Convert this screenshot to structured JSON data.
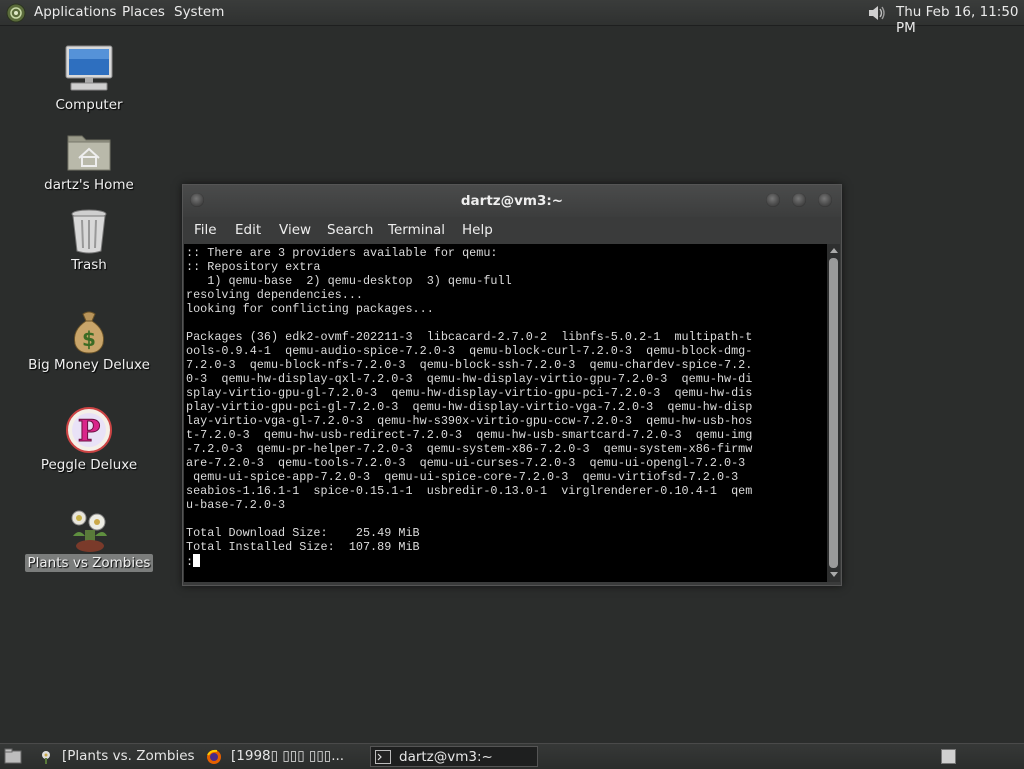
{
  "top_panel": {
    "menus": [
      "Applications",
      "Places",
      "System"
    ],
    "clock": "Thu Feb 16, 11:50 PM",
    "icons": {
      "logo": "mate-logo-icon",
      "volume": "volume-icon"
    }
  },
  "desktop": {
    "icons": [
      {
        "label": "Computer",
        "icon": "computer-icon"
      },
      {
        "label": "dartz's Home",
        "icon": "home-folder-icon"
      },
      {
        "label": "Trash",
        "icon": "trash-icon"
      },
      {
        "label": "Big Money Deluxe",
        "icon": "money-bag-icon"
      },
      {
        "label": "Peggle Deluxe",
        "icon": "peggle-icon"
      },
      {
        "label": "Plants vs Zombies",
        "icon": "plants-vs-zombies-icon",
        "selected": true
      }
    ]
  },
  "terminal": {
    "title": "dartz@vm3:~",
    "menu": [
      "File",
      "Edit",
      "View",
      "Search",
      "Terminal",
      "Help"
    ],
    "lines": [
      ":: There are 3 providers available for qemu:",
      ":: Repository extra",
      "   1) qemu-base  2) qemu-desktop  3) qemu-full",
      "resolving dependencies...",
      "looking for conflicting packages...",
      "",
      "Packages (36) edk2-ovmf-202211-3  libcacard-2.7.0-2  libnfs-5.0.2-1  multipath-t",
      "ools-0.9.4-1  qemu-audio-spice-7.2.0-3  qemu-block-curl-7.2.0-3  qemu-block-dmg-",
      "7.2.0-3  qemu-block-nfs-7.2.0-3  qemu-block-ssh-7.2.0-3  qemu-chardev-spice-7.2.",
      "0-3  qemu-hw-display-qxl-7.2.0-3  qemu-hw-display-virtio-gpu-7.2.0-3  qemu-hw-di",
      "splay-virtio-gpu-gl-7.2.0-3  qemu-hw-display-virtio-gpu-pci-7.2.0-3  qemu-hw-dis",
      "play-virtio-gpu-pci-gl-7.2.0-3  qemu-hw-display-virtio-vga-7.2.0-3  qemu-hw-disp",
      "lay-virtio-vga-gl-7.2.0-3  qemu-hw-s390x-virtio-gpu-ccw-7.2.0-3  qemu-hw-usb-hos",
      "t-7.2.0-3  qemu-hw-usb-redirect-7.2.0-3  qemu-hw-usb-smartcard-7.2.0-3  qemu-img",
      "-7.2.0-3  qemu-pr-helper-7.2.0-3  qemu-system-x86-7.2.0-3  qemu-system-x86-firmw",
      "are-7.2.0-3  qemu-tools-7.2.0-3  qemu-ui-curses-7.2.0-3  qemu-ui-opengl-7.2.0-3",
      " qemu-ui-spice-app-7.2.0-3  qemu-ui-spice-core-7.2.0-3  qemu-virtiofsd-7.2.0-3",
      "seabios-1.16.1-1  spice-0.15.1-1  usbredir-0.13.0-1  virglrenderer-0.10.4-1  qem",
      "u-base-7.2.0-3",
      "",
      "Total Download Size:    25.49 MiB",
      "Total Installed Size:  107.89 MiB",
      ""
    ],
    "prompt": ":"
  },
  "taskbar": {
    "tasks": [
      {
        "label": "[Plants vs. Zombies]",
        "icon": "plants-vs-zombies-icon"
      },
      {
        "label": "[1998▯ ▯▯▯ ▯▯▯...",
        "icon": "firefox-icon"
      },
      {
        "label": "dartz@vm3:~",
        "icon": "terminal-icon",
        "active": true
      }
    ],
    "icons": {
      "show_desktop": "show-desktop-icon",
      "workspace": "workspace-switcher-icon"
    }
  }
}
